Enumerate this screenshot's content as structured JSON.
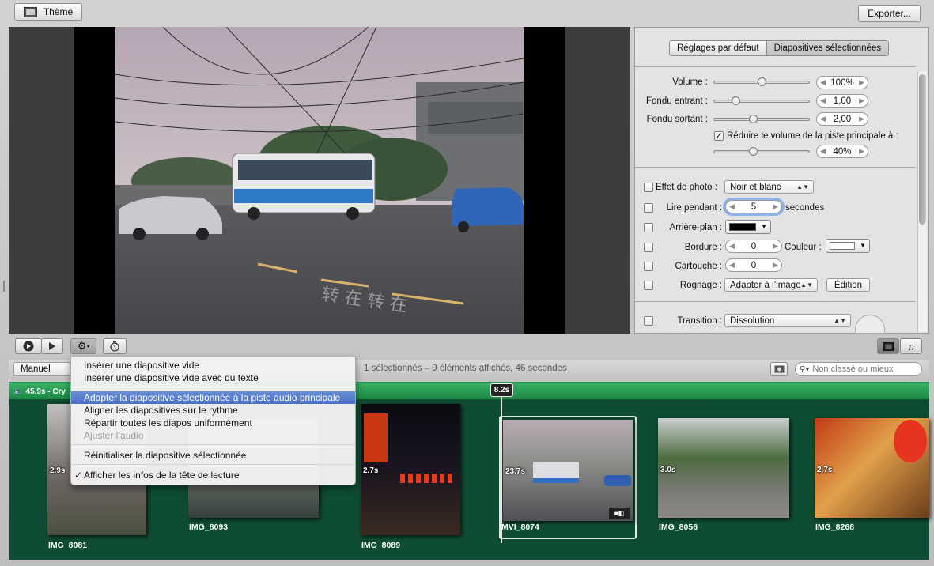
{
  "top": {
    "theme_label": "Thème",
    "export_label": "Exporter..."
  },
  "inspector": {
    "tabs": [
      "Réglages par défaut",
      "Diapositives sélectionnées"
    ],
    "volume": {
      "label": "Volume :",
      "value": "100%",
      "level": 0.5
    },
    "fade_in": {
      "label": "Fondu entrant :",
      "value": "1,00",
      "level": 0.2
    },
    "fade_out": {
      "label": "Fondu sortant :",
      "value": "2,00",
      "level": 0.4
    },
    "duck": {
      "label": "Réduire le volume de la piste principale à :",
      "value": "40%",
      "level": 0.4,
      "checked": true
    },
    "photo_effect": {
      "label": "Effet de photo :",
      "value": "Noir et blanc"
    },
    "play_for": {
      "label": "Lire pendant :",
      "value": "5",
      "unit": "secondes"
    },
    "background": {
      "label": "Arrière-plan :",
      "color": "#000000"
    },
    "border": {
      "label": "Bordure :",
      "value": "0",
      "color_label": "Couleur :",
      "color": "#ffffff"
    },
    "mat": {
      "label": "Cartouche :",
      "value": "0"
    },
    "crop": {
      "label": "Rognage :",
      "value": "Adapter à l’image",
      "edit_label": "Édition"
    },
    "transition": {
      "label": "Transition :",
      "value": "Dissolution"
    }
  },
  "status": {
    "sort_value": "Manuel",
    "summary": "1 sélectionnés – 9 éléments affichés, 46 secondes",
    "filter_placeholder": "Non classé ou mieux"
  },
  "audio_track": {
    "label": "45.9s - Cry",
    "playhead_time": "8.2s"
  },
  "clips": [
    {
      "name": "IMG_8081",
      "duration": "2.9s"
    },
    {
      "name": "IMG_8093",
      "duration": ""
    },
    {
      "name": "IMG_8089",
      "duration": "2.7s"
    },
    {
      "name": "MVI_8074",
      "duration": "23.7s"
    },
    {
      "name": "IMG_8056",
      "duration": "3.0s"
    },
    {
      "name": "IMG_8268",
      "duration": "2.7s"
    }
  ],
  "menu": {
    "items": [
      "Insérer une diapositive vide",
      "Insérer une diapositive vide avec du texte",
      "Adapter la diapositive sélectionnée à la piste audio principale",
      "Aligner les diapositives sur le rythme",
      "Répartir toutes les diapos uniformément",
      "Ajuster l’audio",
      "Réinitialiser la diapositive sélectionnée",
      "Afficher les infos de la tête de lecture"
    ],
    "check_mark": "✓"
  },
  "colors": {
    "timeline_bg": "#0e4c33",
    "audio_bar": "#2a9a5c",
    "menu_highlight": "#4f77cc"
  },
  "icons": [
    "theme-icon",
    "play-icon",
    "play-small-icon",
    "gear-icon",
    "timer-icon",
    "search-icon",
    "filter-icon",
    "music-icon",
    "video-icon",
    "camera-icon",
    "speaker-icon"
  ]
}
